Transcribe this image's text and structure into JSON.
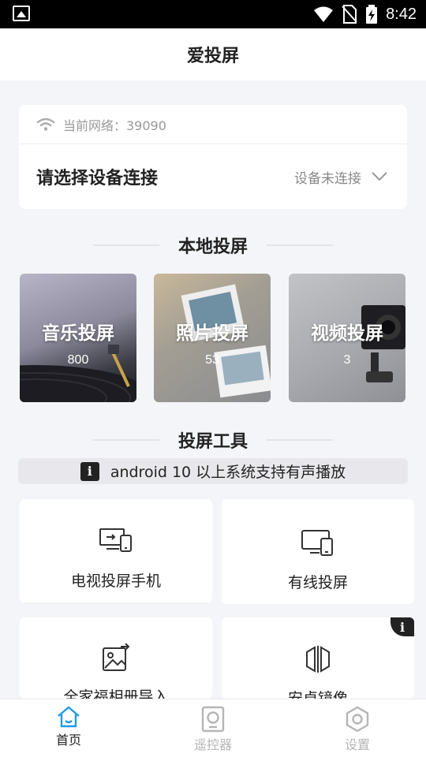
{
  "status_bar": {
    "time": "8:42",
    "icons": [
      "image-icon",
      "wifi-icon",
      "no-sim-icon",
      "battery-charging-icon"
    ]
  },
  "header": {
    "title": "爱投屏"
  },
  "network": {
    "label": "当前网络：39090",
    "choose_device": "请选择设备连接",
    "device_status": "设备未连接"
  },
  "local_section": {
    "title": "本地投屏"
  },
  "media": [
    {
      "name": "音乐投屏",
      "count": "800"
    },
    {
      "name": "照片投屏",
      "count": "53"
    },
    {
      "name": "视频投屏",
      "count": "3"
    }
  ],
  "tools_section": {
    "title": "投屏工具"
  },
  "notice": {
    "text": "android 10 以上系统支持有声播放"
  },
  "tools": [
    {
      "label": "电视投屏手机",
      "icon": "tv-to-phone-icon"
    },
    {
      "label": "有线投屏",
      "icon": "wired-cast-icon"
    },
    {
      "label": "全家福相册导入",
      "icon": "photo-import-icon"
    },
    {
      "label": "安卓镜像",
      "icon": "mirror-icon"
    }
  ],
  "tabs": [
    {
      "label": "首页",
      "icon": "home-icon",
      "active": true
    },
    {
      "label": "遥控器",
      "icon": "remote-icon",
      "active": false
    },
    {
      "label": "设置",
      "icon": "settings-icon",
      "active": false
    }
  ],
  "colors": {
    "accent": "#1e9be6",
    "inactive": "#b5b5b5"
  }
}
